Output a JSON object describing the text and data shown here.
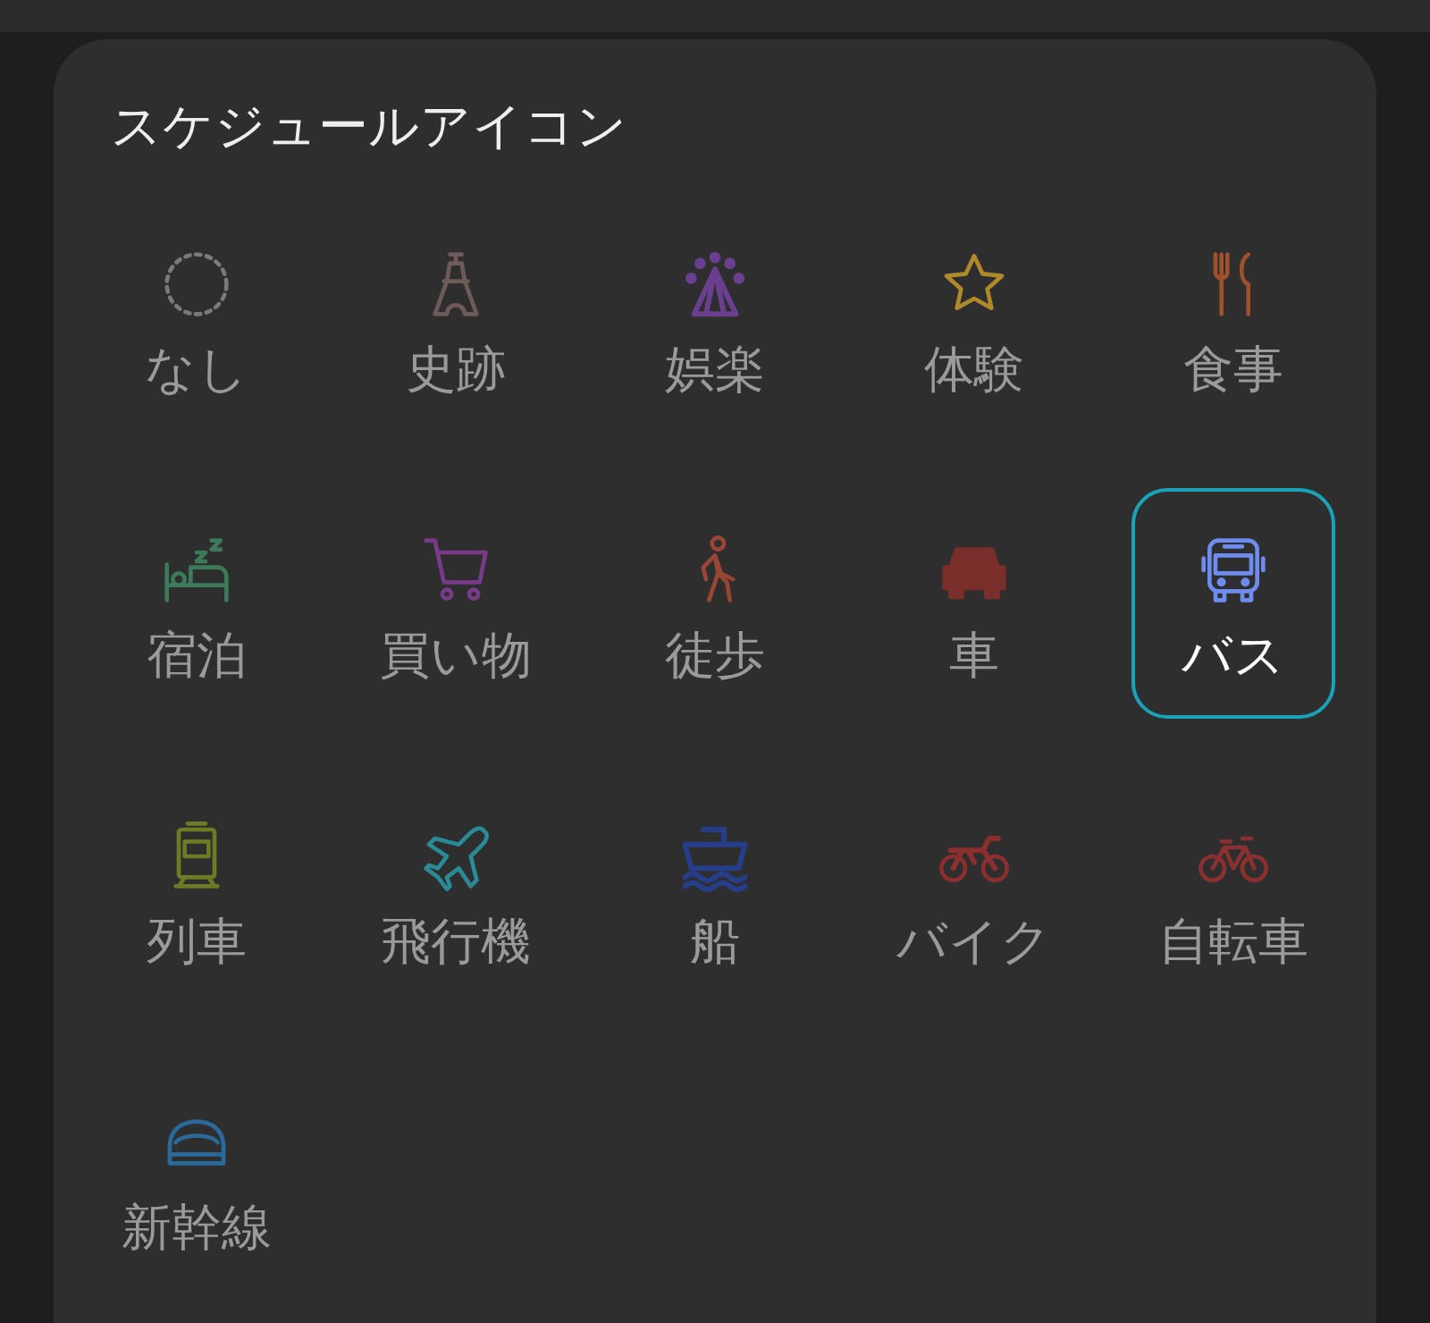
{
  "panel": {
    "title": "スケジュールアイコン"
  },
  "icons": [
    {
      "label": "なし",
      "kind": "none",
      "color": "#7a7a7a",
      "selected": false
    },
    {
      "label": "史跡",
      "kind": "tower",
      "color": "#6e5a58",
      "selected": false
    },
    {
      "label": "娯楽",
      "kind": "ferris",
      "color": "#6a3f8f",
      "selected": false
    },
    {
      "label": "体験",
      "kind": "star",
      "color": "#b08a2a",
      "selected": false
    },
    {
      "label": "食事",
      "kind": "cutlery",
      "color": "#a0512c",
      "selected": false
    },
    {
      "label": "宿泊",
      "kind": "bed",
      "color": "#3d7a5a",
      "selected": false
    },
    {
      "label": "買い物",
      "kind": "cart",
      "color": "#7a3a8a",
      "selected": false
    },
    {
      "label": "徒歩",
      "kind": "walk",
      "color": "#9a4536",
      "selected": false
    },
    {
      "label": "車",
      "kind": "car",
      "color": "#7a2e2a",
      "selected": false
    },
    {
      "label": "バス",
      "kind": "bus",
      "color": "#6e8cf0",
      "selected": true
    },
    {
      "label": "列車",
      "kind": "train",
      "color": "#6e7a24",
      "selected": false
    },
    {
      "label": "飛行機",
      "kind": "plane",
      "color": "#2a8a95",
      "selected": false
    },
    {
      "label": "船",
      "kind": "ship",
      "color": "#263e8a",
      "selected": false
    },
    {
      "label": "バイク",
      "kind": "motorbike",
      "color": "#8a2e2e",
      "selected": false
    },
    {
      "label": "自転車",
      "kind": "bicycle",
      "color": "#8a3030",
      "selected": false
    },
    {
      "label": "新幹線",
      "kind": "shinkansen",
      "color": "#2a6a9a",
      "selected": false
    }
  ]
}
